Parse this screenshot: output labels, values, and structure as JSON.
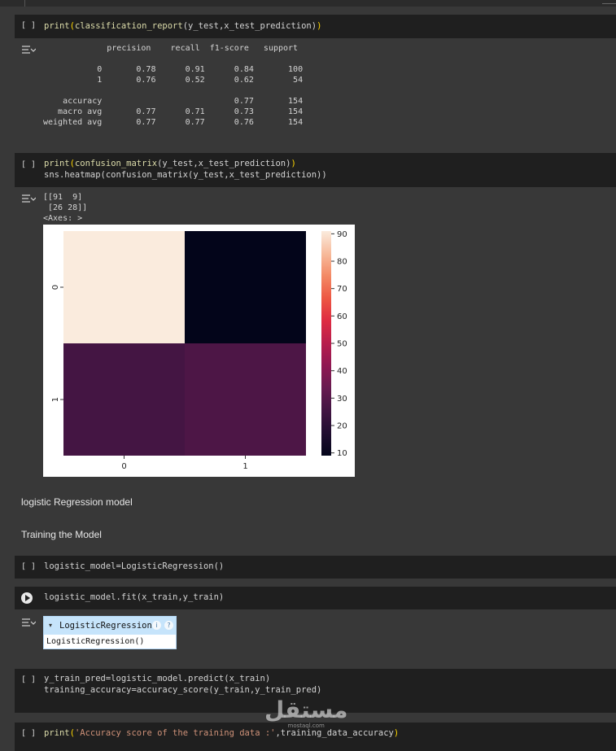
{
  "cells": {
    "c1": {
      "bracket": "[ ]",
      "code_fn": "print",
      "code_paren_open": "(",
      "code_fn2": "classification_report",
      "code_args": "(y_test,x_test_prediction)",
      "code_paren_close": ")"
    },
    "c2": {
      "bracket": "[ ]",
      "line1_fn": "print",
      "line1_open": "(",
      "line1_fn2": "confusion_matrix",
      "line1_args": "(y_test,x_test_prediction)",
      "line1_close": ")",
      "line2": "sns.heatmap(confusion_matrix(y_test,x_test_prediction))"
    },
    "c3": {
      "bracket": "[ ]",
      "code": "logistic_model=LogisticRegression()"
    },
    "c4": {
      "code": "logistic_model.fit(x_train,y_train)"
    },
    "c5": {
      "bracket": "[ ]",
      "line1": "y_train_pred=logistic_model.predict(x_train)",
      "line2": "training_accuracy=accuracy_score(y_train,y_train_pred)"
    },
    "c6": {
      "bracket": "[ ]",
      "fn": "print",
      "open": "(",
      "str": "'Accuracy score of the training data :'",
      "rest": ",training_data_accuracy",
      "close": ")"
    }
  },
  "outputs": {
    "report": [
      "             precision    recall  f1-score   support",
      "",
      "           0       0.78      0.91      0.84       100",
      "           1       0.76      0.52      0.62        54",
      "",
      "    accuracy                           0.77       154",
      "   macro avg       0.77      0.71      0.73       154",
      "weighted avg       0.77      0.77      0.76       154"
    ],
    "confusion": [
      "[[91  9]",
      " [26 28]]",
      "<Axes: >"
    ]
  },
  "markdown": {
    "heading1": "logistic Regression model",
    "heading2": "Training the Model"
  },
  "estimator": {
    "caret": "▾",
    "name": "LogisticRegression",
    "help_icon": "?",
    "info_icon": "i",
    "repr": "LogisticRegression()"
  },
  "watermark": {
    "text": "مستقل",
    "sub": "mostaql.com"
  },
  "colors": {
    "cell_bg": "#1f1f1f",
    "page_bg": "#383838",
    "fn": "#dcdcaa",
    "paren": "#ffd700",
    "string": "#ce9178"
  },
  "chart_data": {
    "type": "heatmap",
    "rows": [
      "0",
      "1"
    ],
    "cols": [
      "0",
      "1"
    ],
    "values": [
      [
        91,
        9
      ],
      [
        26,
        28
      ]
    ],
    "colorbar": {
      "min": 9,
      "max": 91,
      "ticks": [
        10,
        20,
        30,
        40,
        50,
        60,
        70,
        80,
        90
      ]
    },
    "colormap": "rocket"
  }
}
